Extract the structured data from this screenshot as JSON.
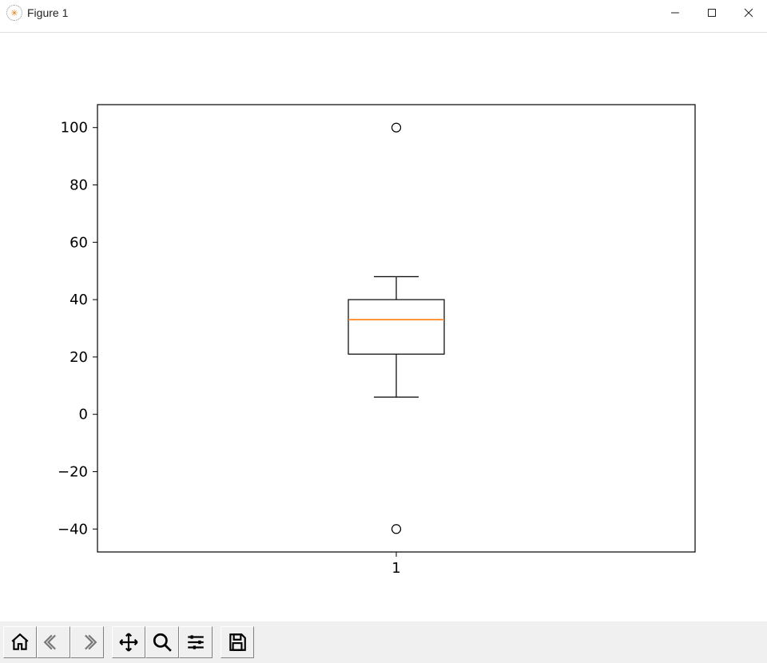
{
  "window": {
    "title": "Figure 1"
  },
  "chart_data": {
    "type": "boxplot",
    "categories": [
      "1"
    ],
    "series": [
      {
        "name": "1",
        "q1": 21,
        "median": 33,
        "q3": 40,
        "whisker_low": 6,
        "whisker_high": 48,
        "outliers": [
          -40,
          100
        ]
      }
    ],
    "yticks": [
      -40,
      -20,
      0,
      20,
      40,
      60,
      80,
      100
    ],
    "ylim": [
      -48,
      108
    ],
    "xlabel": "",
    "ylabel": "",
    "title": ""
  },
  "toolbar": {
    "buttons": [
      {
        "id": "home",
        "label": "Home"
      },
      {
        "id": "back",
        "label": "Back"
      },
      {
        "id": "forward",
        "label": "Forward"
      },
      {
        "id": "pan",
        "label": "Pan"
      },
      {
        "id": "zoom",
        "label": "Zoom"
      },
      {
        "id": "config",
        "label": "Configure subplots"
      },
      {
        "id": "save",
        "label": "Save"
      }
    ]
  }
}
